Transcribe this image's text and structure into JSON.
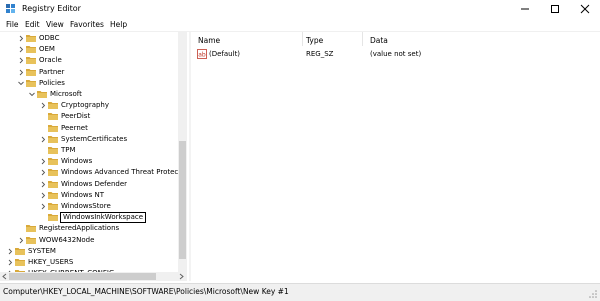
{
  "window": {
    "title": "Registry Editor"
  },
  "menu": [
    "File",
    "Edit",
    "View",
    "Favorites",
    "Help"
  ],
  "tree": {
    "items": [
      {
        "label": "ODBC",
        "indent": 1,
        "expander": "collapsed"
      },
      {
        "label": "OEM",
        "indent": 1,
        "expander": "collapsed"
      },
      {
        "label": "Oracle",
        "indent": 1,
        "expander": "collapsed"
      },
      {
        "label": "Partner",
        "indent": 1,
        "expander": "collapsed"
      },
      {
        "label": "Policies",
        "indent": 1,
        "expander": "expanded"
      },
      {
        "label": "Microsoft",
        "indent": 2,
        "expander": "expanded"
      },
      {
        "label": "Cryptography",
        "indent": 3,
        "expander": "collapsed"
      },
      {
        "label": "PeerDist",
        "indent": 3,
        "expander": "none"
      },
      {
        "label": "Peernet",
        "indent": 3,
        "expander": "none"
      },
      {
        "label": "SystemCertificates",
        "indent": 3,
        "expander": "collapsed"
      },
      {
        "label": "TPM",
        "indent": 3,
        "expander": "none"
      },
      {
        "label": "Windows",
        "indent": 3,
        "expander": "collapsed"
      },
      {
        "label": "Windows Advanced Threat Protection",
        "indent": 3,
        "expander": "collapsed"
      },
      {
        "label": "Windows Defender",
        "indent": 3,
        "expander": "collapsed"
      },
      {
        "label": "Windows NT",
        "indent": 3,
        "expander": "collapsed"
      },
      {
        "label": "WindowsStore",
        "indent": 3,
        "expander": "collapsed"
      },
      {
        "label": "",
        "indent": 3,
        "expander": "none",
        "editing": true
      },
      {
        "label": "RegisteredApplications",
        "indent": 1,
        "expander": "none"
      },
      {
        "label": "WOW6432Node",
        "indent": 1,
        "expander": "collapsed"
      },
      {
        "label": "SYSTEM",
        "indent": 0,
        "expander": "collapsed"
      },
      {
        "label": "HKEY_USERS",
        "indent": 0,
        "expander": "collapsed"
      },
      {
        "label": "HKEY_CURRENT_CONFIG",
        "indent": 0,
        "expander": "collapsed"
      }
    ],
    "edit_value": "WindowsInkWorkspace"
  },
  "values_pane": {
    "columns": [
      "Name",
      "Type",
      "Data"
    ],
    "rows": [
      {
        "name": "(Default)",
        "type": "REG_SZ",
        "data": "(value not set)",
        "icon": "string-value-icon"
      }
    ]
  },
  "status": {
    "path": "Computer\\HKEY_LOCAL_MACHINE\\SOFTWARE\\Policies\\Microsoft\\New Key #1"
  },
  "colors": {
    "folder": "#e8c25b",
    "folder_dark": "#d9a93a",
    "ab_icon": "#c0392b"
  }
}
